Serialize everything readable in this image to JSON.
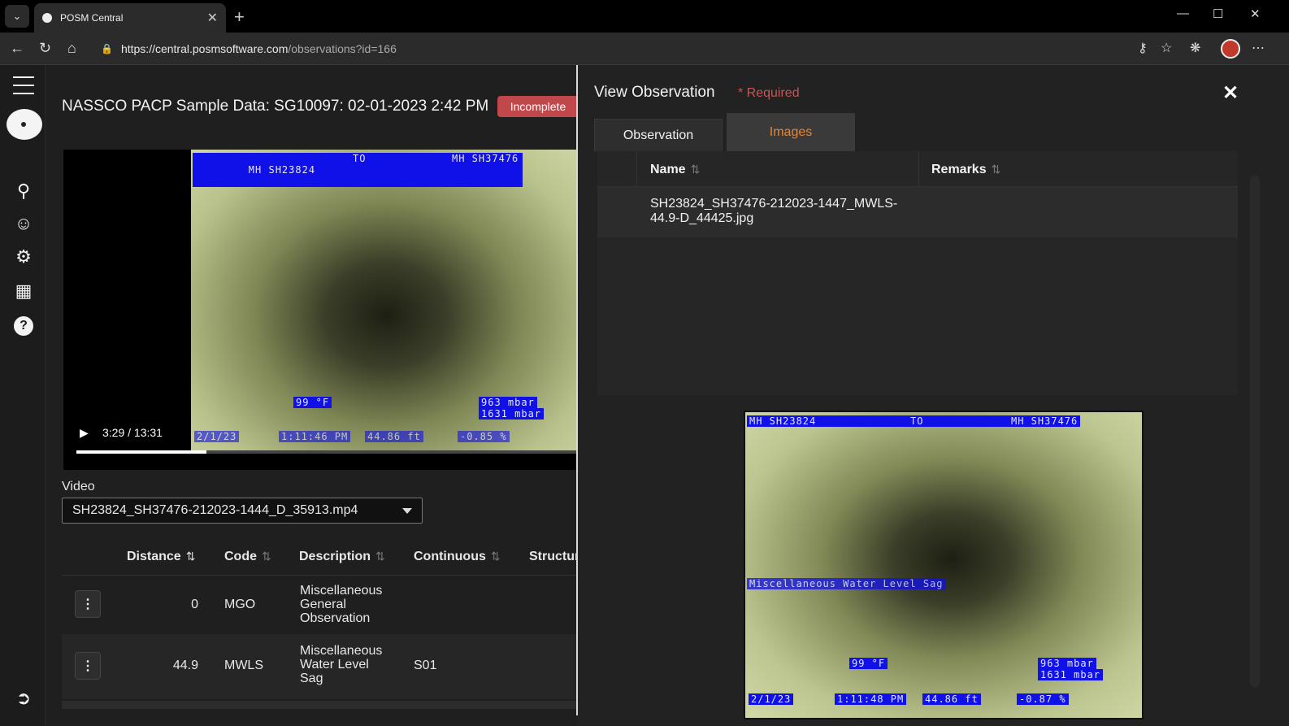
{
  "browser": {
    "tab_title": "POSM Central",
    "url_host": "https://central.posmsoftware.com",
    "url_path": "/observations?id=166"
  },
  "main": {
    "title": "NASSCO PACP Sample Data: SG10097: 02-01-2023 2:42 PM",
    "status_badge": "Incomplete",
    "video": {
      "time": "3:29 / 13:31",
      "progress": 0.26,
      "osd_top_left": "MH SH23824",
      "osd_top_mid": "TO",
      "osd_top_right": "MH SH37476",
      "osd_temp": "99 °F",
      "osd_pressure1": "963 mbar",
      "osd_pressure2": "1631 mbar",
      "osd_date": "2/1/23",
      "osd_time": "1:11:46 PM",
      "osd_dist": "44.86 ft",
      "osd_grade": "-0.85 %"
    },
    "video_label": "Video",
    "video_select": "SH23824_SH37476-212023-1444_D_35913.mp4",
    "grid": {
      "headers": [
        "Distance",
        "Code",
        "Description",
        "Continuous",
        "Structur"
      ],
      "rows": [
        {
          "distance": "0",
          "code": "MGO",
          "description": "Miscellaneous General Observation",
          "continuous": ""
        },
        {
          "distance": "44.9",
          "code": "MWLS",
          "description": "Miscellaneous Water Level Sag",
          "continuous": "S01"
        }
      ]
    }
  },
  "panel": {
    "title": "View Observation",
    "required": "* Required",
    "tabs": [
      "Observation",
      "Images"
    ],
    "table_headers": [
      "Name",
      "Remarks"
    ],
    "image_name": "SH23824_SH37476-212023-1447_MWLS-44.9-D_44425.jpg",
    "preview": {
      "osd_top_left": "MH SH23824",
      "osd_top_mid": "TO",
      "osd_top_right": "MH SH37476",
      "osd_caption": "Miscellaneous Water Level Sag",
      "osd_temp": "99 °F",
      "osd_pressure1": "963 mbar",
      "osd_pressure2": "1631 mbar",
      "osd_date": "2/1/23",
      "osd_time": "1:11:48 PM",
      "osd_dist": "44.86 ft",
      "osd_grade": "-0.87 %"
    }
  },
  "colors": {
    "badge": "#c0474a",
    "active_tab": "#e0883a",
    "osd": "#1010e8"
  }
}
